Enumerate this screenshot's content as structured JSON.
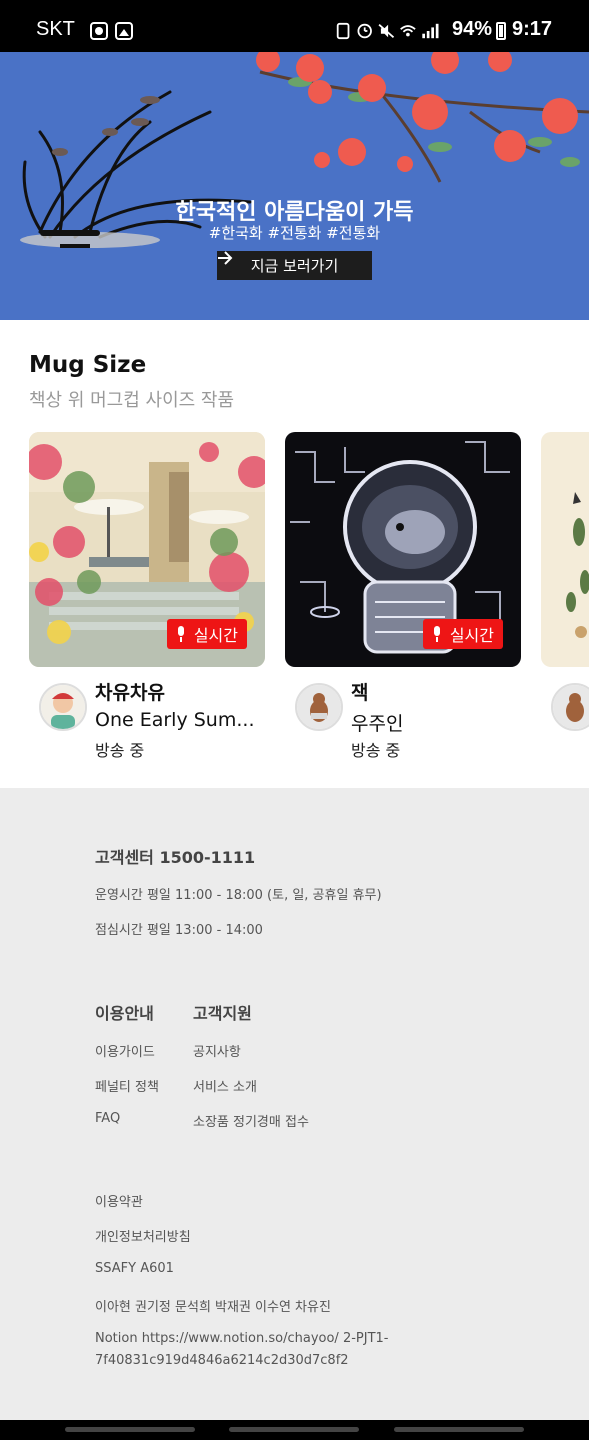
{
  "status_bar": {
    "carrier": "SKT",
    "battery": "94%",
    "time": "9:17"
  },
  "banner": {
    "title": "한국적인 아름다움이 가득",
    "tags": "#한국화 #전통화 #전통화",
    "button_label": "지금 보러가기",
    "background_color": "#4a72c6"
  },
  "section": {
    "title": "Mug Size",
    "subtitle": "책상 위 머그컵 사이즈 작품",
    "cards": [
      {
        "name": "차유차유",
        "title": "One Early Sum...",
        "status": "방송 중",
        "badge": "실시간"
      },
      {
        "name": "잭",
        "title": "우주인",
        "status": "방송 중",
        "badge": "실시간"
      }
    ]
  },
  "footer": {
    "customer_center": "고객센터 1500-1111",
    "hours": "운영시간 평일 11:00 - 18:00 (토, 일, 공휴일 휴무)",
    "lunch": "점심시간 평일 13:00 - 14:00",
    "col1": {
      "heading": "이용안내",
      "links": [
        "이용가이드",
        "페널티 정책",
        "FAQ"
      ]
    },
    "col2": {
      "heading": "고객지원",
      "links": [
        "공지사항",
        "서비스 소개",
        "소장품 정기경매 접수"
      ]
    },
    "terms": "이용약관",
    "privacy": "개인정보처리방침",
    "team": "SSAFY A601",
    "members": "이아현 권기정 문석희 박재권 이수연 차유진",
    "notion_line1": "Notion https://www.notion.so/chayoo/ 2-PJT1-",
    "notion_line2": "7f40831c919d4846a6214c2d30d7c8f2"
  },
  "colors": {
    "live_badge": "#ee1515",
    "footer_bg": "#ececec"
  }
}
